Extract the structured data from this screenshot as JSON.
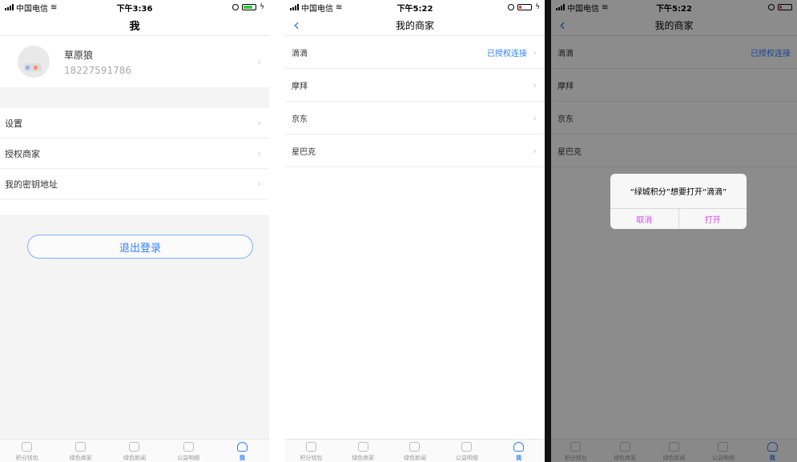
{
  "screen1": {
    "status": {
      "carrier": "中国电信",
      "time": "下午3:36"
    },
    "title": "我",
    "profile": {
      "name": "草原狼",
      "phone": "18227591786"
    },
    "menu": [
      {
        "label": "设置"
      },
      {
        "label": "授权商家"
      },
      {
        "label": "我的密钥地址"
      }
    ],
    "logout_label": "退出登录"
  },
  "screen2": {
    "status": {
      "carrier": "中国电信",
      "time": "下午5:22"
    },
    "title": "我的商家",
    "merchants": [
      {
        "name": "滴滴",
        "status": "已授权连接"
      },
      {
        "name": "摩拜"
      },
      {
        "name": "京东"
      },
      {
        "name": "星巴克"
      }
    ]
  },
  "screen3": {
    "status": {
      "carrier": "中国电信",
      "time": "下午5:22"
    },
    "title": "我的商家",
    "merchants": [
      {
        "name": "滴滴",
        "status": "已授权连接"
      },
      {
        "name": "摩拜"
      },
      {
        "name": "京东"
      },
      {
        "name": "星巴克"
      }
    ],
    "alert": {
      "message": "“绿城积分”想要打开“滴滴”",
      "cancel": "取消",
      "open": "打开"
    }
  },
  "tabs": [
    {
      "label": "积分钱包"
    },
    {
      "label": "绿色商家"
    },
    {
      "label": "绿色新闻"
    },
    {
      "label": "公益明细"
    },
    {
      "label": "我"
    }
  ],
  "colors": {
    "accent": "#2f7fff",
    "alert_button": "#e040fb",
    "battery_green": "#2ecc40",
    "battery_red": "#e53935"
  }
}
